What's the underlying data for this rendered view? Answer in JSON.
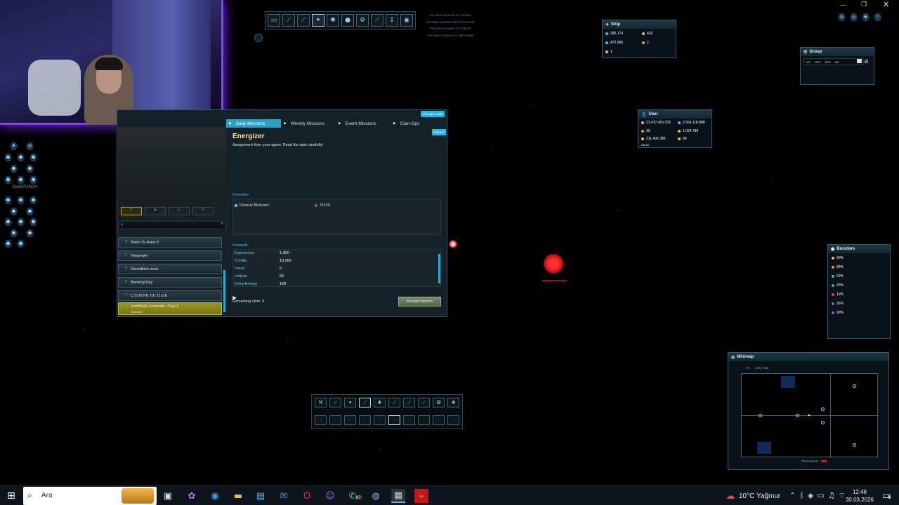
{
  "mission_window": {
    "change_mode_label": "Change mode",
    "refresh_label": "Refresh",
    "tabs": [
      {
        "label": "Daily Missions",
        "active": true
      },
      {
        "label": "Weekly Missions",
        "active": false
      },
      {
        "label": "Event Missions",
        "active": false
      },
      {
        "label": "Clan-Ops",
        "active": false
      }
    ],
    "title": "Energizer",
    "subtitle": "Assignment from your agent. Read the task carefully!",
    "overview_label": "Overview",
    "objective": {
      "label": "Destroy Blobuser",
      "progress": "0/100"
    },
    "rewards_label": "Rewards",
    "rewards": [
      {
        "label": "Experience",
        "value": "1.000"
      },
      {
        "label": "Credits",
        "value": "10.000"
      },
      {
        "label": "Honor",
        "value": "0"
      },
      {
        "label": "uridium",
        "value": "50"
      },
      {
        "label": "Extra-Energy",
        "value": "100"
      }
    ],
    "remaining_slots": "Remaining slots: 0",
    "accept_label": "Accept mission",
    "missions": [
      {
        "label": "Stairs To Astra II"
      },
      {
        "label": "Firepower"
      },
      {
        "label": "Demolition zone"
      },
      {
        "label": "Banking Day"
      },
      {
        "label": "C.O.M.P.E.T.E.T.I.V.E"
      },
      {
        "label": "Justifiable Xenocide - Day 2",
        "sub": "Activated",
        "selected": true
      }
    ]
  },
  "ship_panel": {
    "title": "Ship",
    "stats": [
      "286.174",
      "432",
      "472.666",
      "2",
      "1"
    ]
  },
  "group_panel": {
    "title": "Group",
    "buttons": [
      "NO",
      "ORK",
      "BEE",
      "ME"
    ]
  },
  "user_panel": {
    "title": "User",
    "stats": [
      "21.417.416.239",
      "2.006.118.888",
      "33",
      "1.024.788",
      "211.406.386",
      "99",
      "R6 A0"
    ]
  },
  "boosters_panel": {
    "title": "Boosters",
    "items": [
      {
        "value": "90%",
        "color": "#e0c040"
      },
      {
        "value": "90%",
        "color": "#e09040"
      },
      {
        "value": "62%",
        "color": "#40c0a0"
      },
      {
        "value": "20%",
        "color": "#40c040"
      },
      {
        "value": "10%",
        "color": "#e04040"
      },
      {
        "value": "25%",
        "color": "#4080e0"
      },
      {
        "value": "90%",
        "color": "#c040e0"
      }
    ]
  },
  "minimap": {
    "title": "Minimap",
    "location": "4-4",
    "coords": "344 / 166",
    "threat_level_label": "Threat level"
  },
  "log_messages": [
    "You have received 3.2 uridium",
    "You have received 28 honor points",
    "You have received 15.438 XP",
    "You have received 31.250 credits"
  ],
  "player_name": "BedoPUNCH",
  "taskbar": {
    "search_placeholder": "Ara",
    "weather": "10°C  Yağmur",
    "time": "12:48",
    "date": "30.03.2026",
    "notification_count": "6",
    "whatsapp_badge": "67"
  },
  "colors": {
    "accent": "#3bc2e4",
    "tab_active": "#2d9fc4",
    "selected_mission": "#8c8a1e",
    "title": "#f0e4b0",
    "webcam_glow": "#8a3cff"
  }
}
